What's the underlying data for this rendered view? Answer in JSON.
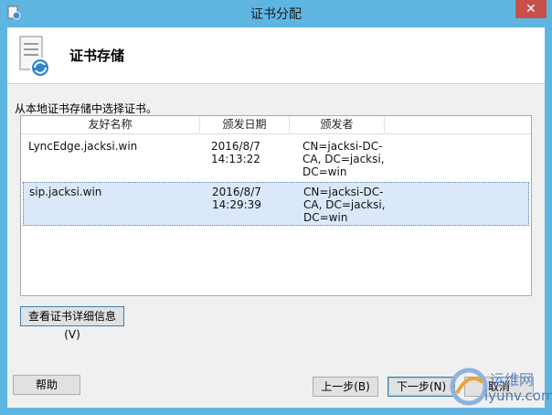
{
  "window": {
    "title": "证书分配",
    "close_glyph": "✕"
  },
  "header": {
    "title": "证书存储"
  },
  "instruction": "从本地证书存储中选择证书。",
  "listview": {
    "columns": [
      "友好名称",
      "颁发日期",
      "颁发者"
    ],
    "rows": [
      {
        "name": "LyncEdge.jacksi.win",
        "date": "2016/8/7",
        "time": "14:13:22",
        "issuer_1": "CN=jacksi-DC-",
        "issuer_2": "CA, DC=jacksi,",
        "issuer_3": "DC=win",
        "selected": false
      },
      {
        "name": "sip.jacksi.win",
        "date": "2016/8/7",
        "time": "14:29:39",
        "issuer_1": "CN=jacksi-DC-",
        "issuer_2": "CA, DC=jacksi,",
        "issuer_3": "DC=win",
        "selected": true
      }
    ]
  },
  "buttons": {
    "view_details": "查看证书详细信息(V)",
    "help": "帮助",
    "back": "上一步(B)",
    "next": "下一步(N)",
    "cancel": "取消"
  },
  "watermark": {
    "line1": "运维网",
    "line2": "iyunv.com"
  },
  "icons": {
    "app": "certificate-app-icon",
    "header": "certificate-store-icon"
  }
}
